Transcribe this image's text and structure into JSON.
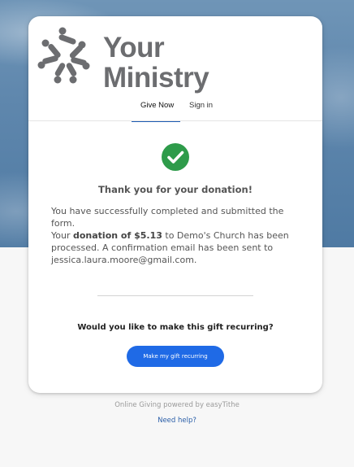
{
  "brand": {
    "name_line1": "Your",
    "name_line2": "Ministry",
    "logo_icon": "starburst-people-logo-icon",
    "text_color": "#6c6d70"
  },
  "tabs": [
    {
      "label": "Give Now",
      "active": true
    },
    {
      "label": "Sign in",
      "active": false
    }
  ],
  "confirmation": {
    "icon": "check-circle-icon",
    "icon_color": "#2e9b4a",
    "heading": "Thank you for your donation!",
    "message": "You have successfully completed and submitted the form.",
    "detail_prefix": "Your ",
    "detail_bold": "donation of $5.13",
    "detail_suffix": " to Demo's Church has been processed. A confirmation email has been sent to jessica.laura.moore@gmail.com."
  },
  "recurring": {
    "question": "Would you like to make this gift recurring?",
    "button_label": "Make my gift recurring",
    "button_color": "#1f6ae6"
  },
  "footer": {
    "powered_by": "Online Giving powered by easyTithe",
    "help_link": "Need help?"
  },
  "colors": {
    "accent": "#1c5bb3",
    "link": "#2a5ea8"
  }
}
